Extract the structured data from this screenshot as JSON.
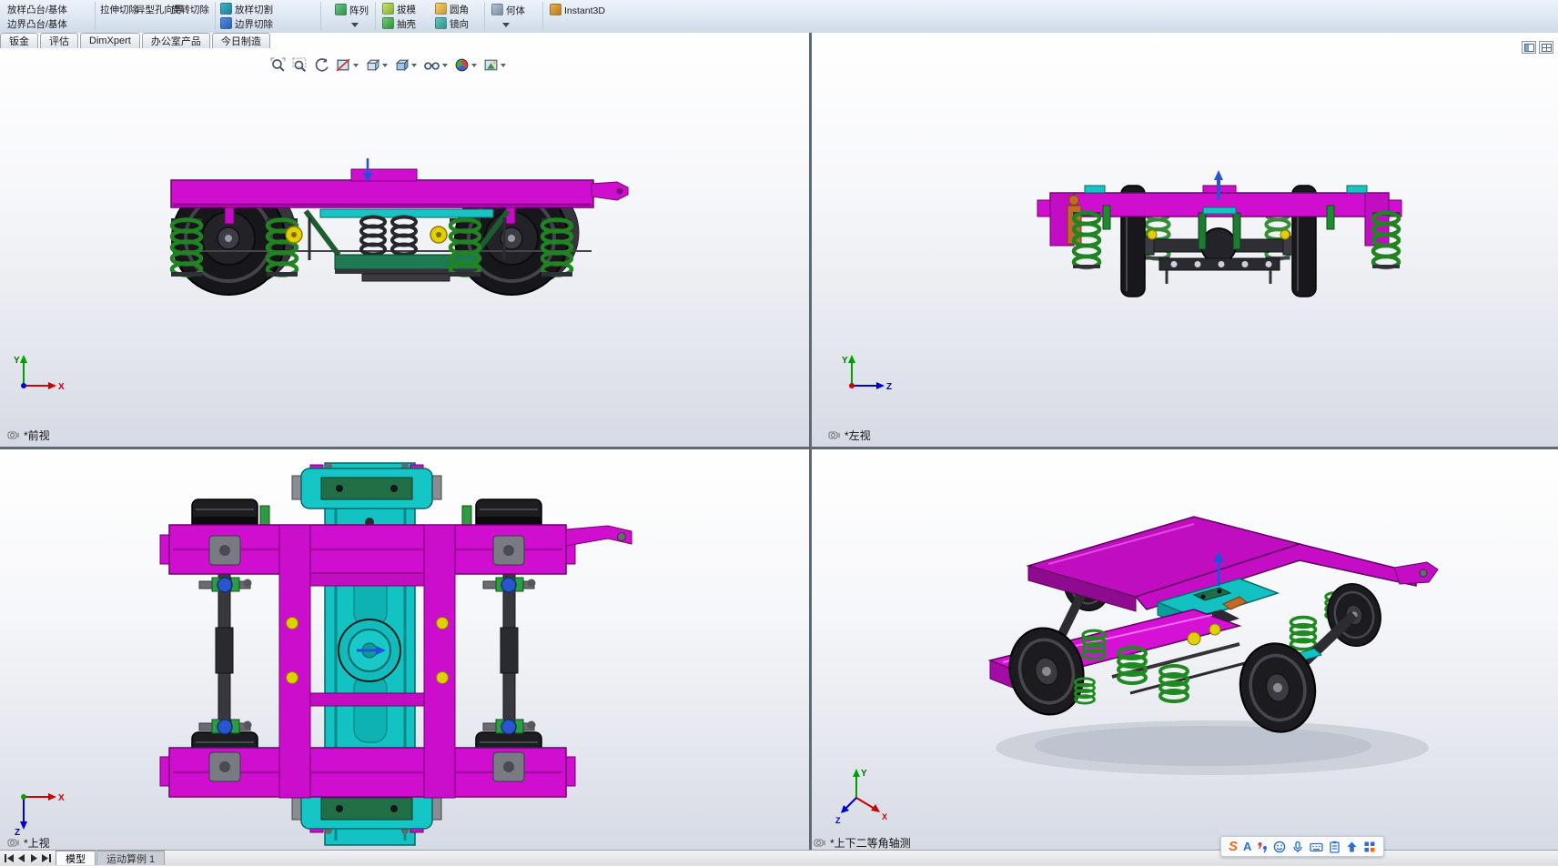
{
  "ribbon": {
    "boss_group": [
      "放样凸台/基体",
      "边界凸台/基体"
    ],
    "cut_columns": [
      "拉伸切除",
      "异型孔向导",
      "旋转切除"
    ],
    "cut_rows": [
      "放样切割",
      "边界切除"
    ],
    "pattern_label": "阵列",
    "feature_grid": [
      "拔模",
      "抽壳",
      "圆角",
      "镜向"
    ],
    "reference_label": "何体",
    "instant3d_label": "Instant3D",
    "icon_names": [
      "lofted-cut-icon",
      "boundary-cut-icon",
      "pattern-icon",
      "draft-icon",
      "shell-icon",
      "fillet-icon",
      "mirror-icon",
      "reference-geometry-icon",
      "instant3d-icon"
    ]
  },
  "command_tabs": [
    "钣金",
    "评估",
    "DimXpert",
    "办公室产品",
    "今日制造"
  ],
  "hud": {
    "buttons": [
      "zoom-fit",
      "zoom-area",
      "previous-view",
      "section-view",
      "view-orientation",
      "display-style",
      "hide-show-items",
      "edit-appearance",
      "apply-scene"
    ]
  },
  "viewports": {
    "front": {
      "label": "*前视",
      "axis_up": "Y",
      "axis_right": "X"
    },
    "left": {
      "label": "*左视",
      "axis_up": "Y",
      "axis_right": "Z"
    },
    "top": {
      "label": "*上视",
      "axis_right": "X",
      "axis_down": "Z"
    },
    "iso": {
      "label": "*上下二等角轴测",
      "axis_up": "Y",
      "axis_lower_right": "X",
      "axis_lower_left": "Z"
    }
  },
  "model_colors": {
    "frame": "#cf0ecf",
    "bolster": "#13c2c2",
    "springs": "#1f8a1f",
    "wheels": "#1a1a1e",
    "accents": "#e2cf00"
  },
  "window_icons": [
    "pane-single-view-icon",
    "pane-four-view-icon"
  ],
  "statusbar": {
    "tabs": [
      "模型",
      "运动算例 1"
    ]
  },
  "ime": {
    "logo": "S",
    "mode": "A",
    "icons": [
      "sogou-logo",
      "ime-mode-icon",
      "punctuation-icon",
      "emoji-icon",
      "voice-input-icon",
      "soft-keyboard-icon",
      "clipboard-icon",
      "skin-up-icon",
      "toolbox-grid-icon"
    ]
  }
}
